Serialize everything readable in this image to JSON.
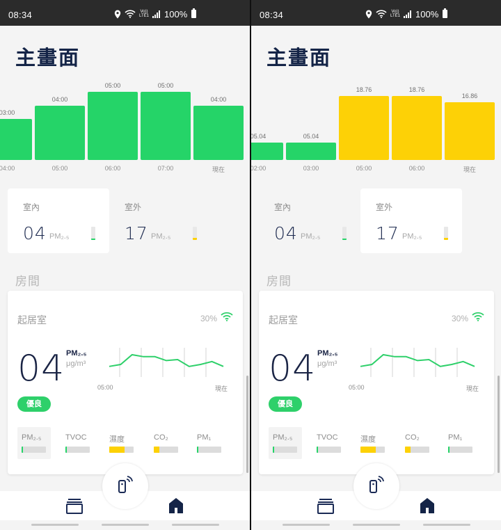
{
  "colors": {
    "green": "#25d468",
    "yellow": "#fdd106",
    "navy": "#142447",
    "statusbar": "#2b2b2b"
  },
  "screens": [
    {
      "status": {
        "time": "08:34",
        "volte": "Vo)) LTE1",
        "battery": "100%"
      },
      "title": "主畫面",
      "chart_data": {
        "type": "bar",
        "categories": [
          "04:00",
          "05:00",
          "06:00",
          "07:00",
          "現在"
        ],
        "values": [
          3,
          4,
          5,
          5,
          4
        ],
        "labels": [
          "03:00",
          "04:00",
          "05:00",
          "05:00",
          "04:00"
        ],
        "colors": [
          "#25d468",
          "#25d468",
          "#25d468",
          "#25d468",
          "#25d468"
        ],
        "ylim": [
          0,
          5
        ]
      },
      "indoor": {
        "title": "室內",
        "value": "04",
        "unit": "PM₂.₅",
        "level": 0.05,
        "color": "#25d468"
      },
      "outdoor": {
        "title": "室外",
        "value": "17",
        "unit": "PM₂.₅",
        "level": 0.15,
        "color": "#fdd106"
      },
      "rooms_title": "房間",
      "room": {
        "name": "起居室",
        "signal": "30%",
        "value": "04",
        "pm_label": "PM₂.₅",
        "unit": "μg/m³",
        "status": "優良",
        "spark_start": "05:00",
        "spark_end": "現在",
        "spark": [
          8,
          10,
          20,
          18,
          18,
          14,
          15,
          8,
          10,
          13,
          8
        ],
        "metrics": [
          {
            "label": "PM₂.₅",
            "level": 0.06,
            "color": "#25d468"
          },
          {
            "label": "TVOC",
            "level": 0.04,
            "color": "#25d468"
          },
          {
            "label": "濕度",
            "level": 0.62,
            "color": "#fdd106"
          },
          {
            "label": "CO₂",
            "level": 0.22,
            "color": "#fdd106"
          },
          {
            "label": "PM₁",
            "level": 0.05,
            "color": "#25d468"
          }
        ]
      }
    },
    {
      "status": {
        "time": "08:34",
        "volte": "Vo)) LTE1",
        "battery": "100%"
      },
      "title": "主畫面",
      "chart_data": {
        "type": "bar",
        "categories": [
          "02:00",
          "03:00",
          "05:00",
          "06:00",
          "現在"
        ],
        "values": [
          5.04,
          5.04,
          18.76,
          18.76,
          16.86
        ],
        "labels": [
          "05.04",
          "05.04",
          "18.76",
          "18.76",
          "16.86"
        ],
        "colors": [
          "#25d468",
          "#25d468",
          "#fdd106",
          "#fdd106",
          "#fdd106"
        ],
        "ylim": [
          0,
          20
        ]
      },
      "indoor": {
        "title": "室內",
        "value": "04",
        "unit": "PM₂.₅",
        "level": 0.05,
        "color": "#25d468"
      },
      "outdoor": {
        "title": "室外",
        "value": "17",
        "unit": "PM₂.₅",
        "level": 0.15,
        "color": "#fdd106"
      },
      "rooms_title": "房間",
      "room": {
        "name": "起居室",
        "signal": "30%",
        "value": "04",
        "pm_label": "PM₂.₅",
        "unit": "μg/m³",
        "status": "優良",
        "spark_start": "05:00",
        "spark_end": "現在",
        "spark": [
          8,
          10,
          20,
          18,
          18,
          14,
          15,
          8,
          10,
          13,
          8
        ],
        "metrics": [
          {
            "label": "PM₂.₅",
            "level": 0.06,
            "color": "#25d468"
          },
          {
            "label": "TVOC",
            "level": 0.04,
            "color": "#25d468"
          },
          {
            "label": "濕度",
            "level": 0.62,
            "color": "#fdd106"
          },
          {
            "label": "CO₂",
            "level": 0.22,
            "color": "#fdd106"
          },
          {
            "label": "PM₁",
            "level": 0.05,
            "color": "#25d468"
          }
        ]
      }
    }
  ]
}
